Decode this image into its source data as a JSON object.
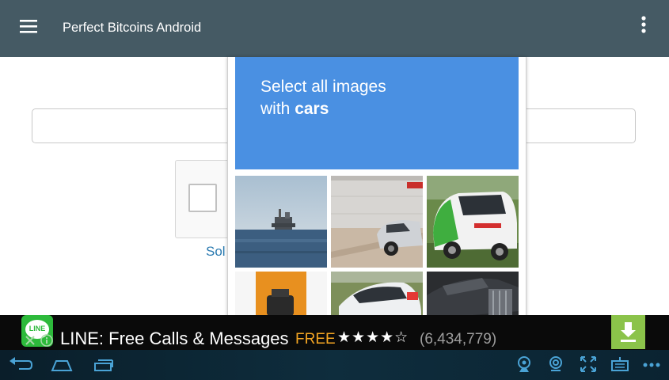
{
  "app": {
    "title": "Perfect Bitcoins Android"
  },
  "page": {
    "url_input_value": "",
    "solve_link_label": "Sol"
  },
  "challenge": {
    "line1": "Select all images",
    "line2_prefix": "with ",
    "line2_bold": "cars",
    "tiles": [
      {
        "subject": "offshore-oil-rig-on-sea"
      },
      {
        "subject": "car-parked-by-wall"
      },
      {
        "subject": "green-white-smart-car"
      },
      {
        "subject": "orange-object"
      },
      {
        "subject": "white-car-on-grass"
      },
      {
        "subject": "motorcycle"
      }
    ]
  },
  "ad": {
    "title": "LINE: Free Calls & Messages",
    "price": "FREE",
    "stars": "★★★★☆",
    "rating_count": "(6,434,779)",
    "logo_text": "LINE",
    "colors": {
      "price": "#f5a623",
      "download": "#8bc34a",
      "logo": "#2dba3b"
    }
  },
  "colors": {
    "appbar": "#455a64",
    "challenge_header": "#4a90e2",
    "link": "#2a7ab0"
  },
  "icons": {
    "menu": "hamburger-menu",
    "overflow": "vertical-dots",
    "nav_back": "back-arrow",
    "nav_home": "home",
    "nav_recents": "recent-apps",
    "webcam": "webcam",
    "location": "gps-location",
    "fullscreen": "fullscreen",
    "keyboard": "keyboard",
    "more": "more-dots",
    "download": "download-arrow"
  }
}
